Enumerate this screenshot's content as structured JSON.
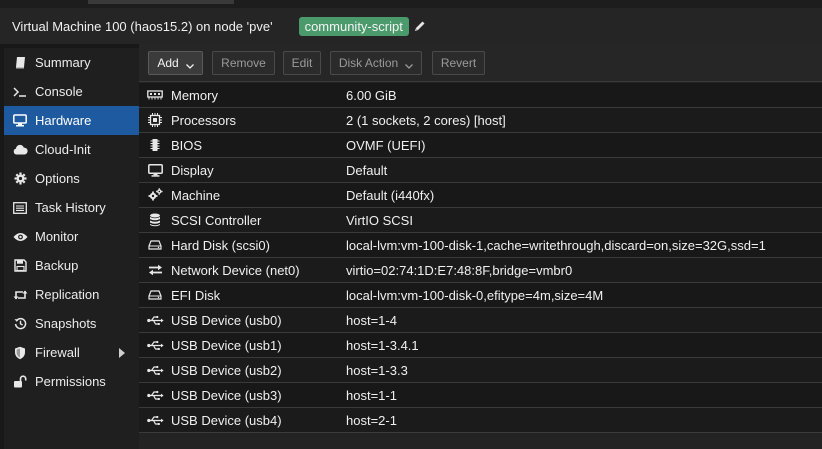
{
  "header": {
    "title": "Virtual Machine 100 (haos15.2) on node 'pve'",
    "tag": "community-script",
    "tag_color": "#4a9a6c"
  },
  "sidebar": {
    "items": [
      {
        "label": "Summary",
        "icon": "book-icon"
      },
      {
        "label": "Console",
        "icon": "terminal-icon"
      },
      {
        "label": "Hardware",
        "icon": "desktop-icon",
        "active": true
      },
      {
        "label": "Cloud-Init",
        "icon": "cloud-icon"
      },
      {
        "label": "Options",
        "icon": "gear-icon"
      },
      {
        "label": "Task History",
        "icon": "list-icon"
      },
      {
        "label": "Monitor",
        "icon": "eye-icon"
      },
      {
        "label": "Backup",
        "icon": "floppy-icon"
      },
      {
        "label": "Replication",
        "icon": "retweet-icon"
      },
      {
        "label": "Snapshots",
        "icon": "history-icon"
      },
      {
        "label": "Firewall",
        "icon": "shield-icon"
      },
      {
        "label": "Permissions",
        "icon": "unlock-icon"
      }
    ]
  },
  "toolbar": {
    "add": "Add",
    "remove": "Remove",
    "edit": "Edit",
    "disk_action": "Disk Action",
    "revert": "Revert"
  },
  "hardware": [
    {
      "key": "Memory",
      "value": "6.00 GiB",
      "icon": "memory-icon"
    },
    {
      "key": "Processors",
      "value": "2 (1 sockets, 2 cores) [host]",
      "icon": "cpu-icon"
    },
    {
      "key": "BIOS",
      "value": "OVMF (UEFI)",
      "icon": "microchip-icon"
    },
    {
      "key": "Display",
      "value": "Default",
      "icon": "monitor-icon"
    },
    {
      "key": "Machine",
      "value": "Default (i440fx)",
      "icon": "cogs-icon"
    },
    {
      "key": "SCSI Controller",
      "value": "VirtIO SCSI",
      "icon": "database-icon"
    },
    {
      "key": "Hard Disk (scsi0)",
      "value": "local-lvm:vm-100-disk-1,cache=writethrough,discard=on,size=32G,ssd=1",
      "icon": "hdd-icon"
    },
    {
      "key": "Network Device (net0)",
      "value": "virtio=02:74:1D:E7:48:8F,bridge=vmbr0",
      "icon": "exchange-icon"
    },
    {
      "key": "EFI Disk",
      "value": "local-lvm:vm-100-disk-0,efitype=4m,size=4M",
      "icon": "hdd-icon"
    },
    {
      "key": "USB Device (usb0)",
      "value": "host=1-4",
      "icon": "usb-icon"
    },
    {
      "key": "USB Device (usb1)",
      "value": "host=1-3.4.1",
      "icon": "usb-icon"
    },
    {
      "key": "USB Device (usb2)",
      "value": "host=1-3.3",
      "icon": "usb-icon"
    },
    {
      "key": "USB Device (usb3)",
      "value": "host=1-1",
      "icon": "usb-icon"
    },
    {
      "key": "USB Device (usb4)",
      "value": "host=2-1",
      "icon": "usb-icon"
    }
  ]
}
